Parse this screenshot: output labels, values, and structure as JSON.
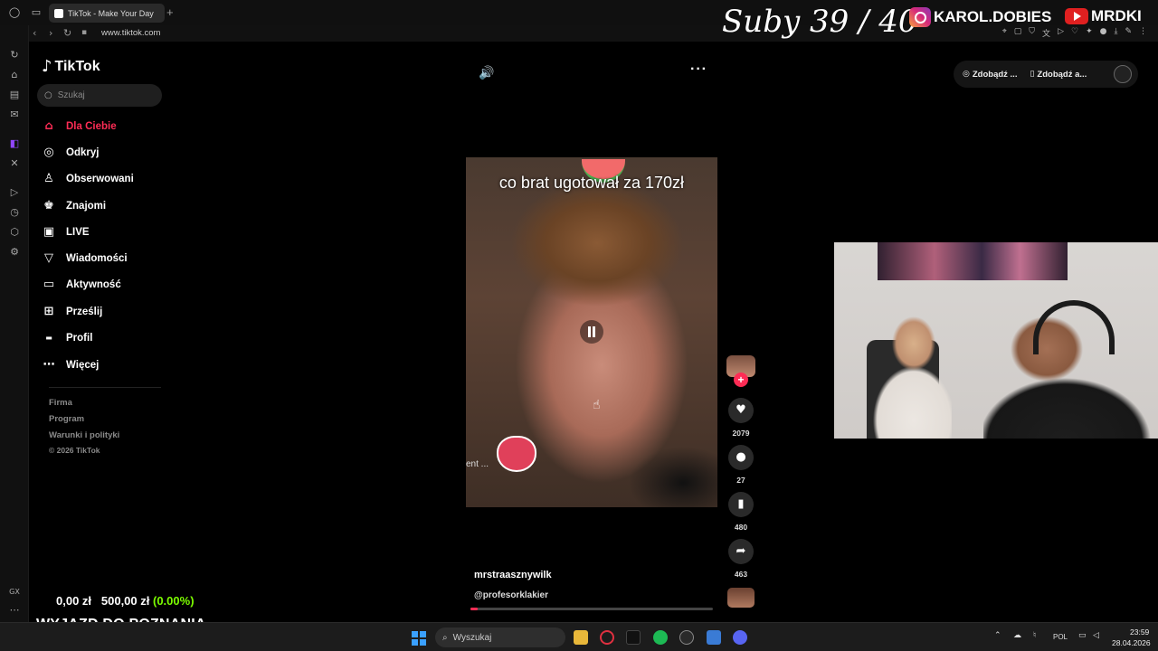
{
  "browser": {
    "tab_title": "TikTok - Make Your Day",
    "new_tab": "+",
    "url": "www.tiktok.com",
    "nav": {
      "back": "‹",
      "forward": "›",
      "reload": "↻",
      "lock": "🔒"
    }
  },
  "stream_overlay": {
    "subs_text": "Suby 39 / 40",
    "instagram": "KAROL.DOBIES",
    "youtube": "MRDKI",
    "wallet_amount": "0,00 zł",
    "wallet_target": "500,00 zł",
    "wallet_percent": "(0.00%)",
    "stream_title": "WYJAZD DO POZNANIA"
  },
  "tiktok": {
    "logo_text": "TikTok",
    "search_placeholder": "Szukaj",
    "nav_items": [
      {
        "label": "Dla Ciebie",
        "icon": "home-icon",
        "active": true
      },
      {
        "label": "Odkryj",
        "icon": "compass-icon"
      },
      {
        "label": "Obserwowani",
        "icon": "following-icon"
      },
      {
        "label": "Znajomi",
        "icon": "friends-icon"
      },
      {
        "label": "LIVE",
        "icon": "live-icon"
      },
      {
        "label": "Wiadomości",
        "icon": "messages-icon"
      },
      {
        "label": "Aktywność",
        "icon": "activity-icon"
      },
      {
        "label": "Prześlij",
        "icon": "upload-icon"
      },
      {
        "label": "Profil",
        "icon": "profile-icon"
      },
      {
        "label": "Więcej",
        "icon": "more-icon"
      }
    ],
    "footer_links": [
      "Firma",
      "Program",
      "Warunki i polityki",
      "© 2026 TikTok"
    ],
    "top_right": {
      "chip1": "Zdobądź ...",
      "chip2": "Zdobądź a..."
    },
    "video": {
      "caption": "co brat ugotował za 170zł",
      "ghost_text": "ent ...",
      "author_name": "mrstraasznywilk",
      "sound_handle": "@profesorklakier",
      "progress_percent": 3
    },
    "actions": {
      "likes": "2079",
      "comments": "27",
      "saves": "480",
      "shares": "463"
    }
  },
  "taskbar": {
    "search_label": "Wyszukaj",
    "language": "POL",
    "time": "23:59",
    "date": "28.04.2026"
  },
  "colors": {
    "tiktok_accent": "#fe2c55",
    "wallet_percent": "#7cfc00",
    "background": "#000000"
  }
}
